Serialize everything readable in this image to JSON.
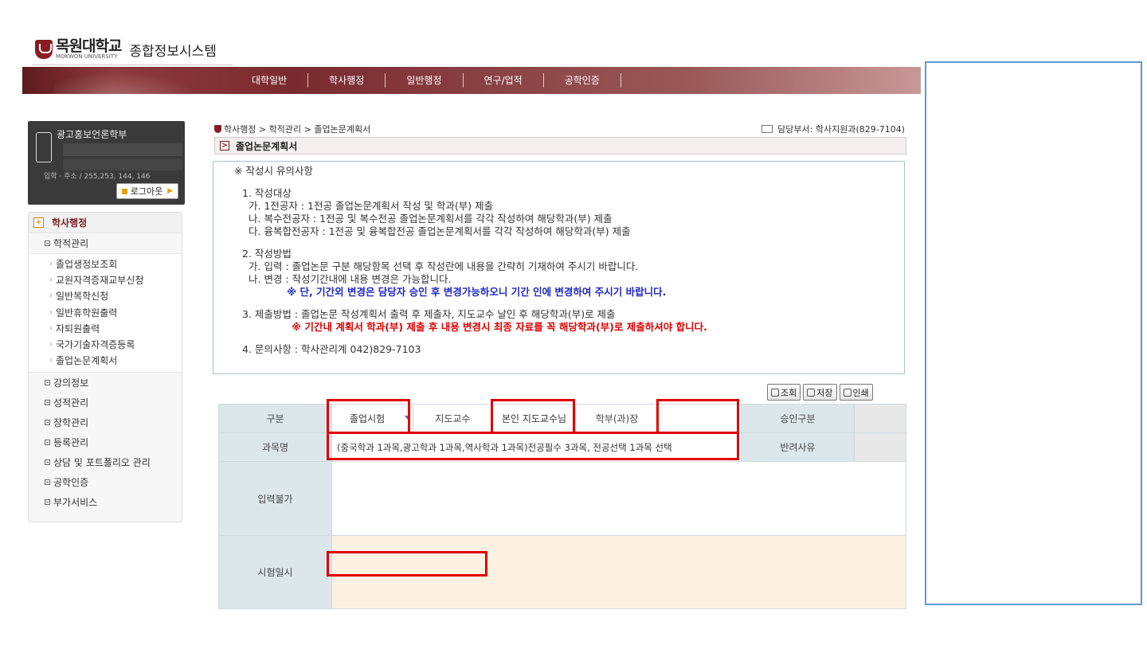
{
  "header": {
    "university_name": "목원대학교",
    "university_en": "MOKWON UNIVERSITY",
    "system_name": "종합정보시스템"
  },
  "topnav": {
    "items": [
      "대학일반",
      "학사행정",
      "일반행정",
      "연구/업적",
      "공학인증"
    ]
  },
  "user": {
    "department": "광고홍보언론학부",
    "info_line": "입학 · 주소 / 255,253, 144, 146",
    "logout_label": "로그아웃"
  },
  "sidebar": {
    "section": "학사행정",
    "groups": [
      {
        "label": "학적관리",
        "items": [
          "졸업생정보조회",
          "교원자격증재교부신청",
          "일반복학신청",
          "일반휴학원출력",
          "자퇴원출력",
          "국가기술자격증등록",
          "졸업논문계획서"
        ]
      },
      {
        "label": "강의정보"
      },
      {
        "label": "성적관리"
      },
      {
        "label": "장학관리"
      },
      {
        "label": "등록관리"
      },
      {
        "label": "상담 및 포트폴리오 관리"
      },
      {
        "label": "공학인증"
      },
      {
        "label": "부가서비스"
      }
    ]
  },
  "breadcrumb": "학사행정 > 학적관리 > 졸업논문계획서",
  "dept_info": "담당부서: 학사지원과(829-7104)",
  "page_title": "졸업논문계획서",
  "notice": {
    "heading": "※ 작성시 유의사항",
    "s1_title": "1. 작성대상",
    "s1_a": "가. 1전공자  : 1전공 졸업논문계획서 작성 및 학과(부) 제출",
    "s1_b": "나. 복수전공자 : 1전공 및 복수전공 졸업논문계획서를 각각 작성하여 해당학과(부) 제출",
    "s1_c": "다. 융복합전공자 : 1전공 및 융복합전공 졸업논문계획서를 각각 작성하여 해당학과(부) 제출",
    "s2_title": "2. 작성방법",
    "s2_a": "가. 입력 : 졸업논문 구분 해당항목 선택 후 작성란에 내용을 간략히 기재하여 주시기 바랍니다.",
    "s2_b": "나. 변경 : 작성기간내에 내용 변경은 가능합니다.",
    "s2_note": "※ 단, 기간외 변경은 담당자 승인 후 변경가능하오니 기간 인에 변경하여 주시기 바랍니다.",
    "s3_title": "3. 제출방법 : 졸업논문 작성계획서 출력 후  제출자, 지도교수 날인 후 해당학과(부)로 제출",
    "s3_note": "※ 기간내 계획서 학과(부) 제출 후 내용 변경시 최종 자료를 꼭 해당학과(부)로 제출하셔야 합니다.",
    "s4_title": "4. 문의사항 : 학사관리계 042)829-7103"
  },
  "buttons": {
    "search": "조회",
    "save": "저장",
    "print": "인쇄"
  },
  "form": {
    "type_label": "구분",
    "type_value": "졸업시험",
    "advisor_label": "지도교수",
    "advisor_value": "본인 지도교수님",
    "head_label": "학부(과)장",
    "head_value": "",
    "approval_label": "승인구분",
    "approval_value": "",
    "subject_label": "과목명",
    "subject_value": "(중국학과 1과목,광고학과 1과목,역사학과 1과목)전공필수 3과목, 전공선택 1과목 선택",
    "reject_label": "반려사유",
    "reject_value": "",
    "input_label": "입력불가",
    "exam_date_label": "시험일시"
  },
  "colors": {
    "nav_primary": "#7a2a2e",
    "annotation_red": "#e00000",
    "panel_blue": "#5b9bd5",
    "label_bg": "#dce7ec",
    "exam_row_bg": "#fdf2e2"
  }
}
